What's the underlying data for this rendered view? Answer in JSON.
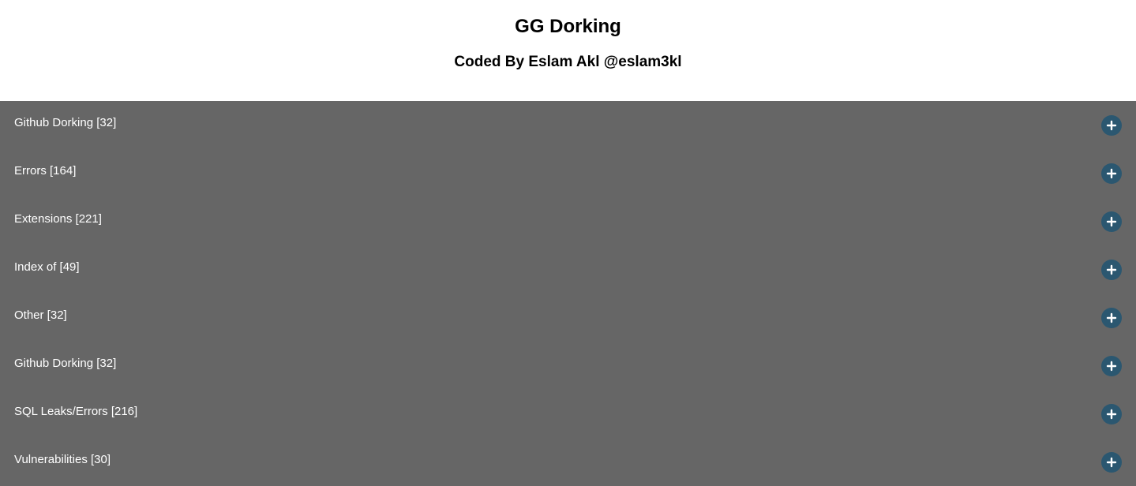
{
  "header": {
    "title": "GG Dorking",
    "subtitle": "Coded By Eslam Akl @eslam3kl"
  },
  "colors": {
    "accordion_background": "#666666",
    "toggle_background": "#2b5770",
    "label_text": "#ffffff"
  },
  "accordion": {
    "toggle_icon": "plus-icon",
    "items": [
      {
        "label": "Github Dorking [32]"
      },
      {
        "label": "Errors [164]"
      },
      {
        "label": "Extensions [221]"
      },
      {
        "label": "Index of [49]"
      },
      {
        "label": "Other [32]"
      },
      {
        "label": "Github Dorking [32]"
      },
      {
        "label": "SQL Leaks/Errors [216]"
      },
      {
        "label": "Vulnerabilities [30]"
      }
    ]
  }
}
